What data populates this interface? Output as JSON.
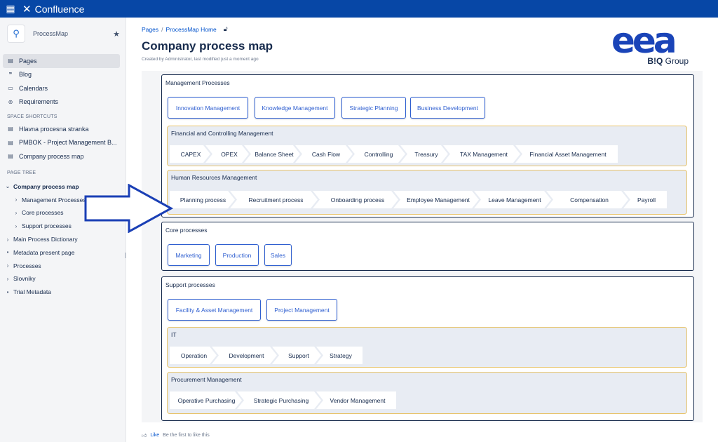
{
  "app": {
    "name": "Confluence"
  },
  "space": {
    "name": "ProcessMap"
  },
  "nav": [
    {
      "label": "Pages",
      "icon": "page-icon"
    },
    {
      "label": "Blog",
      "icon": "quote-icon"
    },
    {
      "label": "Calendars",
      "icon": "calendar-icon"
    },
    {
      "label": "Requirements",
      "icon": "requirements-icon"
    }
  ],
  "shortcuts": {
    "label": "SPACE SHORTCUTS",
    "items": [
      "Hlavna procesna stranka",
      "PMBOK - Project Management B...",
      "Company process map"
    ]
  },
  "tree": {
    "label": "PAGE TREE",
    "items": [
      {
        "label": "Company process map",
        "caret": "⌄",
        "level": 0
      },
      {
        "label": "Management Processes",
        "caret": "›",
        "level": 1
      },
      {
        "label": "Core processes",
        "caret": "›",
        "level": 1
      },
      {
        "label": "Support processes",
        "caret": "›",
        "level": 1
      },
      {
        "label": "Main Process Dictionary",
        "caret": "›",
        "level": 0
      },
      {
        "label": "Metadata present page",
        "caret": "•",
        "level": 0
      },
      {
        "label": "Processes",
        "caret": "›",
        "level": 0
      },
      {
        "label": "Slovniky",
        "caret": "›",
        "level": 0
      },
      {
        "label": "Trial Metadata",
        "caret": "•",
        "level": 0
      }
    ]
  },
  "breadcrumb": {
    "root": "Pages",
    "sep": "/",
    "current": "ProcessMap Home"
  },
  "page": {
    "title": "Company process map",
    "byline": "Created by Administrator, last modified just a moment ago"
  },
  "brand": {
    "mark": "eea",
    "sub_bold": "B!Q",
    "sub": " Group"
  },
  "map": {
    "management": {
      "title": "Management Processes",
      "buttons": [
        "Innovation Management",
        "Knowledge Management",
        "Strategic Planning",
        "Business Development"
      ],
      "financial": {
        "title": "Financial and Controlling Management",
        "steps": [
          "CAPEX",
          "OPEX",
          "Balance Sheet",
          "Cash Flow",
          "Controlling",
          "Treasury",
          "TAX Management",
          "Financial Asset Management"
        ]
      },
      "hr": {
        "title": "Human Resources Management",
        "steps": [
          "Planning process",
          "Recruitment process",
          "Onboarding process",
          "Employee Management",
          "Leave Management",
          "Compensation",
          "Payroll"
        ]
      }
    },
    "core": {
      "title": "Core processes",
      "buttons": [
        "Marketing",
        "Production",
        "Sales"
      ]
    },
    "support": {
      "title": "Support processes",
      "buttons": [
        "Facility & Asset Management",
        "Project Management"
      ],
      "it": {
        "title": "IT",
        "steps": [
          "Operation",
          "Development",
          "Support",
          "Strategy"
        ]
      },
      "procurement": {
        "title": "Procurement Management",
        "steps": [
          "Operative Purchasing",
          "Strategic Purchasing",
          "Vendor Management"
        ]
      }
    }
  },
  "footer": {
    "like": "Like",
    "note": "Be the first to like this"
  },
  "colors": {
    "topbar": "#0747a6",
    "accent": "#2f5fd0",
    "subgroup_border": "#e8c46a"
  }
}
